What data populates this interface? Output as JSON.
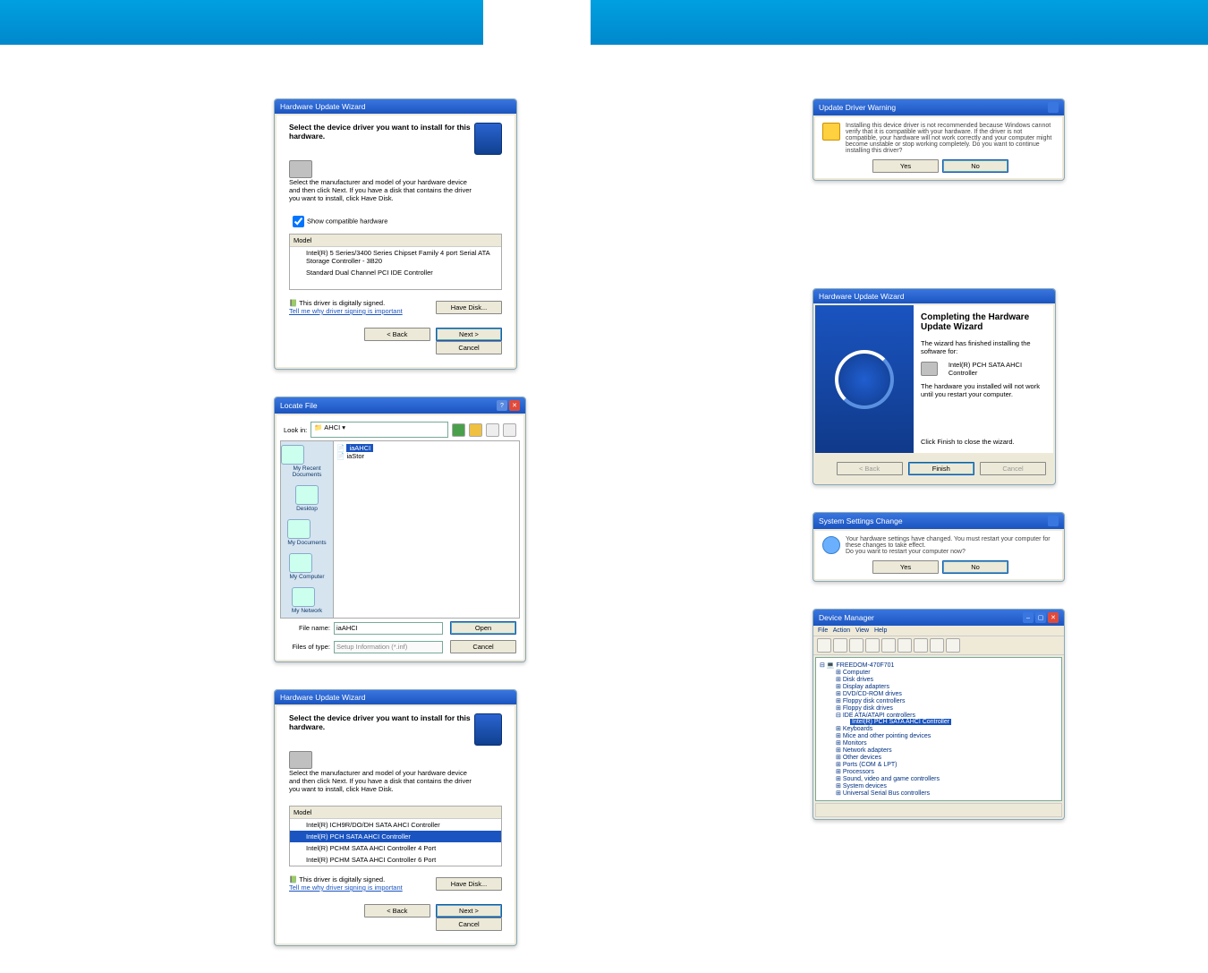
{
  "hw1": {
    "title": "Hardware Update Wizard",
    "subtitle": "Select the device driver you want to install for this hardware.",
    "instr": "Select the manufacturer and model of your hardware device and then click Next. If you have a disk that contains the driver you want to install, click Have Disk.",
    "chk": "Show compatible hardware",
    "model_header": "Model",
    "models": [
      "Intel(R) 5 Series/3400 Series Chipset Family 4 port Serial ATA Storage Controller - 3B20",
      "Standard Dual Channel PCI IDE Controller"
    ],
    "signed": "This driver is digitally signed.",
    "tell": "Tell me why driver signing is important",
    "have_disk": "Have Disk...",
    "back": "< Back",
    "next": "Next >",
    "cancel": "Cancel"
  },
  "locate": {
    "title": "Locate File",
    "lookin_label": "Look in:",
    "lookin_value": "AHCI",
    "files": {
      "selected": "iaAHCI",
      "other": "iaStor"
    },
    "side": [
      "My Recent Documents",
      "Desktop",
      "My Documents",
      "My Computer",
      "My Network"
    ],
    "filename_label": "File name:",
    "filename_value": "iaAHCI",
    "type_label": "Files of type:",
    "type_value": "Setup Information (*.inf)",
    "open": "Open",
    "cancel": "Cancel"
  },
  "hw2": {
    "title": "Hardware Update Wizard",
    "subtitle": "Select the device driver you want to install for this hardware.",
    "instr": "Select the manufacturer and model of your hardware device and then click Next. If you have a disk that contains the driver you want to install, click Have Disk.",
    "model_header": "Model",
    "models": [
      "Intel(R) ICH9R/DO/DH SATA AHCI Controller",
      "Intel(R) PCH SATA AHCI Controller",
      "Intel(R) PCHM SATA AHCI Controller 4 Port",
      "Intel(R) PCHM SATA AHCI Controller 6 Port"
    ],
    "signed": "This driver is digitally signed.",
    "tell": "Tell me why driver signing is important",
    "have_disk": "Have Disk...",
    "back": "< Back",
    "next": "Next >",
    "cancel": "Cancel"
  },
  "warning": {
    "title": "Update Driver Warning",
    "text": "Installing this device driver is not recommended because Windows cannot verify that it is compatible with your hardware. If the driver is not compatible, your hardware will not work correctly and your computer might become unstable or stop working completely. Do you want to continue installing this driver?",
    "yes": "Yes",
    "no": "No"
  },
  "complete": {
    "title": "Hardware Update Wizard",
    "heading": "Completing the Hardware Update Wizard",
    "line1": "The wizard has finished installing the software for:",
    "device": "Intel(R) PCH SATA AHCI Controller",
    "line2": "The hardware you installed will not work until you restart your computer.",
    "line3": "Click Finish to close the wizard.",
    "back": "< Back",
    "finish": "Finish",
    "cancel": "Cancel"
  },
  "settings": {
    "title": "System Settings Change",
    "text": "Your hardware settings have changed. You must restart your computer for these changes to take effect.",
    "q": "Do you want to restart your computer now?",
    "yes": "Yes",
    "no": "No"
  },
  "dm": {
    "title": "Device Manager",
    "menu": [
      "File",
      "Action",
      "View",
      "Help"
    ],
    "root": "FREEDOM-470F701",
    "nodes": [
      "Computer",
      "Disk drives",
      "Display adapters",
      "DVD/CD-ROM drives",
      "Floppy disk controllers",
      "Floppy disk drives"
    ],
    "ide_parent": "IDE ATA/ATAPI controllers",
    "ide_sel": "Intel(R) PCH SATA AHCI Controller",
    "nodes2": [
      "Keyboards",
      "Mice and other pointing devices",
      "Monitors",
      "Network adapters",
      "Other devices",
      "Ports (COM & LPT)",
      "Processors",
      "Sound, video and game controllers",
      "System devices",
      "Universal Serial Bus controllers"
    ]
  }
}
